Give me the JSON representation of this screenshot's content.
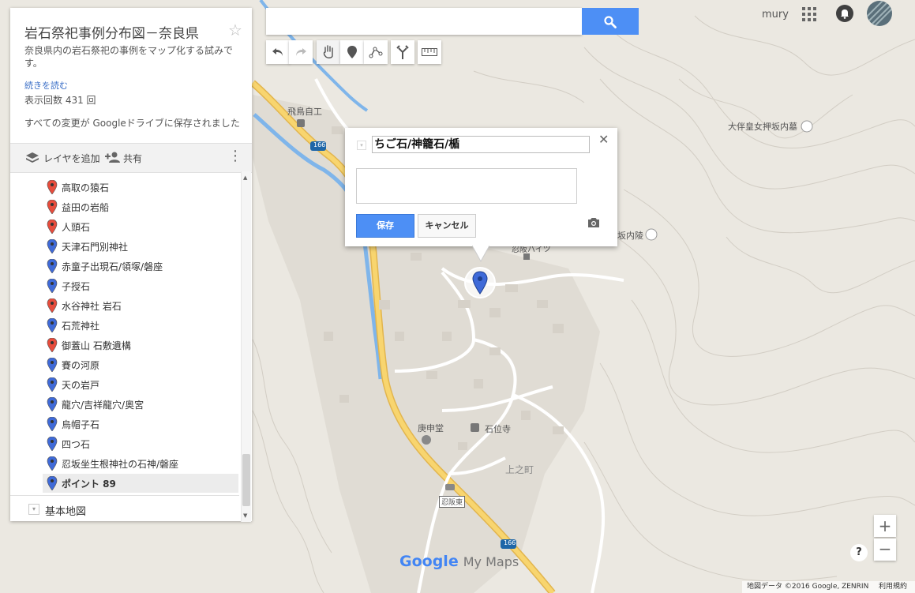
{
  "panel": {
    "title": "岩石祭祀事例分布図－奈良県",
    "description": "奈良県内の岩石祭祀の事例をマップ化する試みです。",
    "read_more": "続きを読む",
    "views": "表示回数 431 回",
    "saved_status": "すべての変更が Googleドライブに保存されました",
    "add_layer": "レイヤを追加",
    "share": "共有",
    "base_map": "基本地図",
    "items": [
      {
        "label": "高取の猿石",
        "color": "red"
      },
      {
        "label": "益田の岩船",
        "color": "red"
      },
      {
        "label": "人頭石",
        "color": "red"
      },
      {
        "label": "天津石門別神社",
        "color": "blue"
      },
      {
        "label": "赤童子出現石/領塚/磐座",
        "color": "blue"
      },
      {
        "label": "子授石",
        "color": "blue"
      },
      {
        "label": "水谷神社 岩石",
        "color": "red"
      },
      {
        "label": "石荒神社",
        "color": "blue"
      },
      {
        "label": "御蓋山 石敷遺構",
        "color": "red"
      },
      {
        "label": "賽の河原",
        "color": "blue"
      },
      {
        "label": "天の岩戸",
        "color": "blue"
      },
      {
        "label": "龍穴/吉祥龍穴/奥宮",
        "color": "blue"
      },
      {
        "label": "烏帽子石",
        "color": "blue"
      },
      {
        "label": "四つ石",
        "color": "blue"
      },
      {
        "label": "忍坂坐生根神社の石神/磐座",
        "color": "blue"
      },
      {
        "label": "ポイント 89",
        "color": "blue",
        "selected": true
      }
    ]
  },
  "search": {
    "placeholder": ""
  },
  "toolbar": [
    "undo-icon",
    "redo-icon",
    "hand-icon",
    "marker-icon",
    "draw-line-icon",
    "directions-icon",
    "ruler-icon"
  ],
  "header": {
    "user": "mury"
  },
  "popup": {
    "title_value": "ちご石/神籠石/楯",
    "save": "保存",
    "cancel": "キャンセル"
  },
  "map": {
    "labels": {
      "asuka": "飛鳥自工",
      "otomo": "大伴皇女押坂内墓",
      "misaka": "坂内陵",
      "koshindo": "庚申堂",
      "ishiiji": "石位寺",
      "uenomachi": "上之町",
      "oshisaka": "忍阪東",
      "road1": "166",
      "road2": "166",
      "partial": "忍阪ハイツ"
    }
  },
  "brand": {
    "google": "Google",
    "mymaps": "My Maps"
  },
  "footer": {
    "attribution": "地図データ ©2016 Google, ZENRIN",
    "terms": "利用規約"
  },
  "colors": {
    "blue_pin": "#3f6ad8",
    "red_pin": "#e74c3c",
    "accent": "#4d8ff5",
    "road": "#f5c04a"
  }
}
